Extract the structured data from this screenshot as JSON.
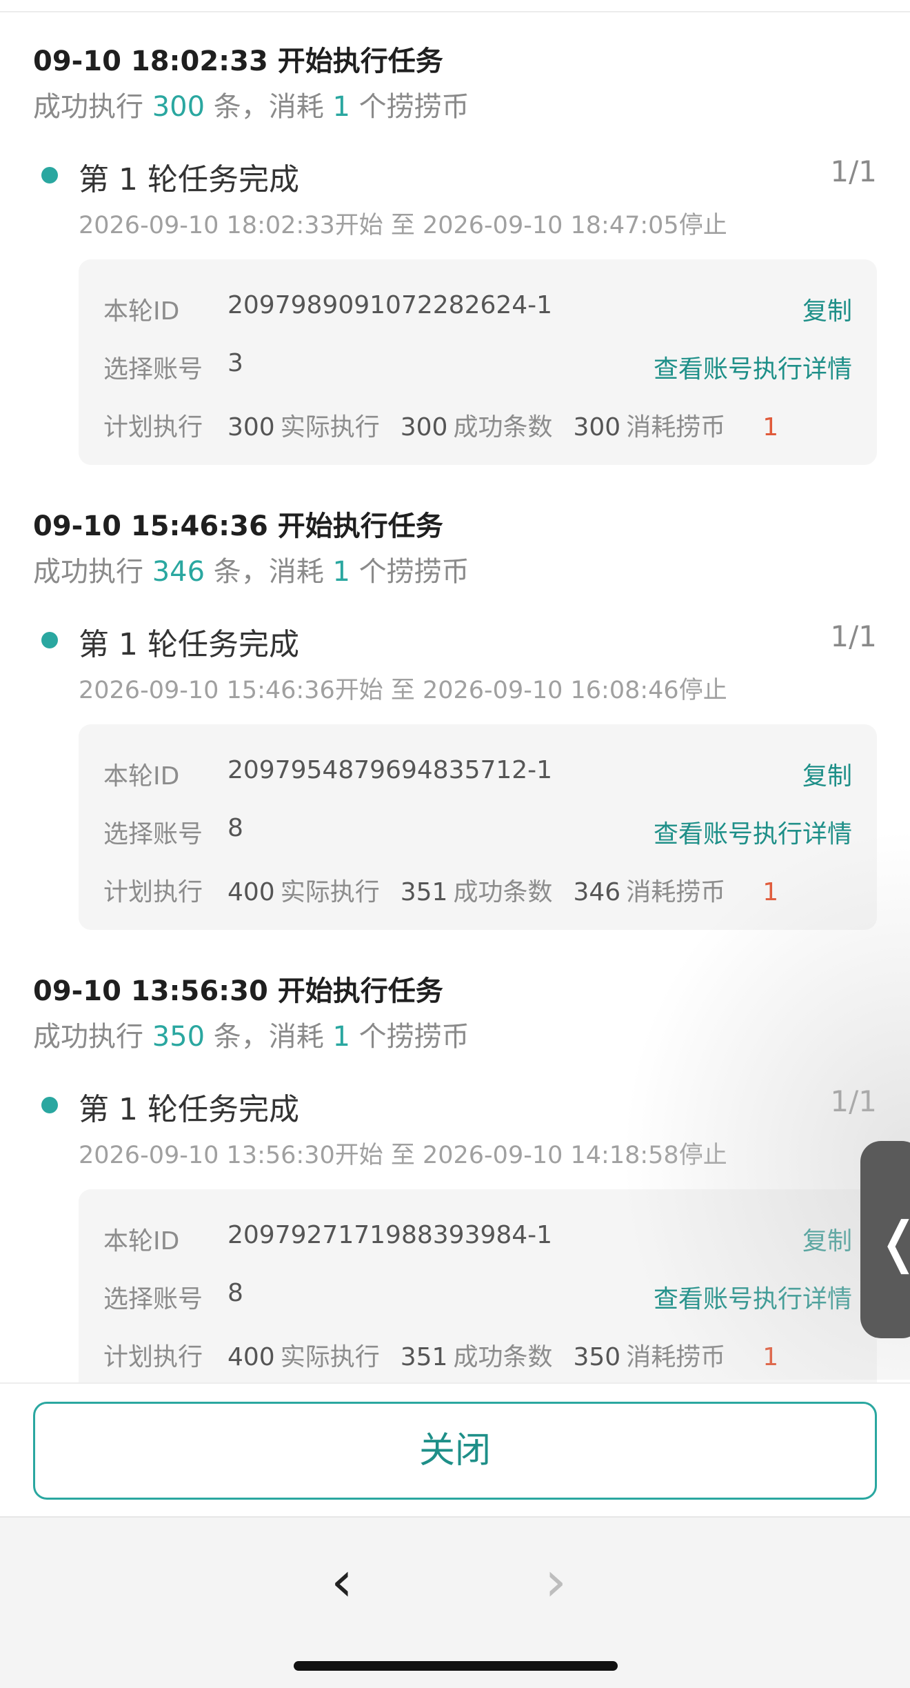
{
  "tasks": [
    {
      "title": "09-10 18:02:33 开始执行任务",
      "summary": {
        "prefix": "成功执行 ",
        "count": "300",
        "middle": " 条，消耗 ",
        "coins": "1",
        "suffix": " 个捞捞币"
      },
      "round": {
        "title": "第 1 轮任务完成",
        "count": "1/1",
        "time": "2026-09-10 18:02:33开始 至 2026-09-10 18:47:05停止",
        "id_label": "本轮ID",
        "id_value": "2097989091072282624-1",
        "copy_label": "复制",
        "account_label": "选择账号",
        "account_value": "3",
        "detail_link": "查看账号执行详情",
        "plan_label": "计划执行",
        "plan_value": "300",
        "actual_label": "实际执行",
        "actual_value": "300",
        "success_label": "成功条数",
        "success_value": "300",
        "cost_label": "消耗捞币",
        "cost_value": "1"
      }
    },
    {
      "title": "09-10 15:46:36 开始执行任务",
      "summary": {
        "prefix": "成功执行 ",
        "count": "346",
        "middle": " 条，消耗 ",
        "coins": "1",
        "suffix": " 个捞捞币"
      },
      "round": {
        "title": "第 1 轮任务完成",
        "count": "1/1",
        "time": "2026-09-10 15:46:36开始 至 2026-09-10 16:08:46停止",
        "id_label": "本轮ID",
        "id_value": "2097954879694835712-1",
        "copy_label": "复制",
        "account_label": "选择账号",
        "account_value": "8",
        "detail_link": "查看账号执行详情",
        "plan_label": "计划执行",
        "plan_value": "400",
        "actual_label": "实际执行",
        "actual_value": "351",
        "success_label": "成功条数",
        "success_value": "346",
        "cost_label": "消耗捞币",
        "cost_value": "1"
      }
    },
    {
      "title": "09-10 13:56:30 开始执行任务",
      "summary": {
        "prefix": "成功执行 ",
        "count": "350",
        "middle": " 条，消耗 ",
        "coins": "1",
        "suffix": " 个捞捞币"
      },
      "round": {
        "title": "第 1 轮任务完成",
        "count": "1/1",
        "time": "2026-09-10 13:56:30开始 至 2026-09-10 14:18:58停止",
        "id_label": "本轮ID",
        "id_value": "2097927171988393984-1",
        "copy_label": "复制",
        "account_label": "选择账号",
        "account_value": "8",
        "detail_link": "查看账号执行详情",
        "plan_label": "计划执行",
        "plan_value": "400",
        "actual_label": "实际执行",
        "actual_value": "351",
        "success_label": "成功条数",
        "success_value": "350",
        "cost_label": "消耗捞币",
        "cost_value": "1"
      }
    }
  ],
  "side_tab": {
    "icon": "chevron-left-icon",
    "glyph": "❬"
  },
  "close_button": {
    "label": "关闭"
  },
  "browser_nav": {
    "back_glyph": "‹",
    "forward_glyph": "›"
  },
  "colors": {
    "accent": "#2aa7a0",
    "accent_dark": "#1e8f88",
    "cost_red": "#e05a3a",
    "card_bg": "#f5f5f5"
  }
}
